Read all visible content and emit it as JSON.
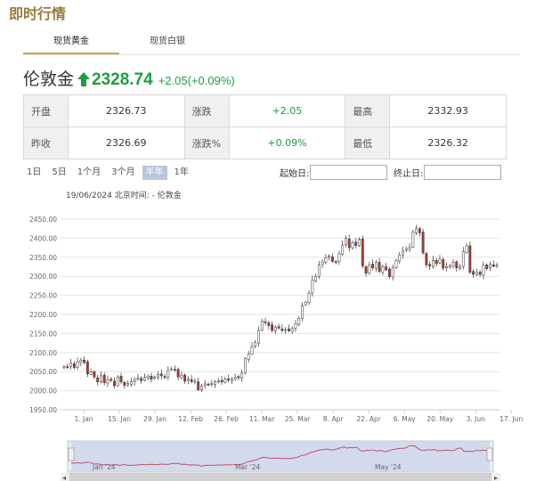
{
  "page": {
    "title": "即时行情"
  },
  "tabs": [
    {
      "label": "现货黄金",
      "active": true
    },
    {
      "label": "现货白银",
      "active": false
    }
  ],
  "quote": {
    "name": "伦敦金",
    "price": "2328.74",
    "change": "+2.05(+0.09%)",
    "direction_icon": "up-arrow-icon",
    "up_color": "#1e9e3e",
    "table": {
      "open_label": "开盘",
      "open": "2326.73",
      "change_label": "涨跌",
      "change": "+2.05",
      "high_label": "最高",
      "high": "2332.93",
      "prev_close_label": "昨收",
      "prev_close": "2326.69",
      "change_pct_label": "涨跌%",
      "change_pct": "+0.09%",
      "low_label": "最低",
      "low": "2326.32"
    }
  },
  "range_buttons": [
    {
      "label": "1日",
      "active": false
    },
    {
      "label": "5日",
      "active": false
    },
    {
      "label": "1个月",
      "active": false
    },
    {
      "label": "3个月",
      "active": false
    },
    {
      "label": "半年",
      "active": true
    },
    {
      "label": "1年",
      "active": false
    }
  ],
  "date_range": {
    "start_label": "起始日:",
    "start_value": "",
    "end_label": "终止日:",
    "end_value": ""
  },
  "chart": {
    "caption": "19/06/2024 北京时间: - 伦敦金",
    "y_ticks": [
      "2450.00",
      "2400.00",
      "2350.00",
      "2300.00",
      "2250.00",
      "2200.00",
      "2150.00",
      "2100.00",
      "2050.00",
      "2000.00",
      "1950.00"
    ],
    "x_ticks": [
      "1. Jan",
      "15. Jan",
      "29. Jan",
      "12. Feb",
      "26. Feb",
      "11. Mar",
      "25. Mar",
      "8. Apr",
      "22. Apr",
      "6. May",
      "20. May",
      "3. Jun",
      "17. Jun"
    ],
    "navigator_labels": [
      "Jan '24",
      "Mar '24",
      "May '24"
    ],
    "up_color": "#ffffff",
    "down_color": "#b03a2e",
    "wick_color": "#333333",
    "navigator_line_color": "#c0506a"
  },
  "chart_data": {
    "type": "candlestick",
    "title": "",
    "ylim": [
      1950,
      2450
    ],
    "x_first": "2024-01-01",
    "closes": [
      2063,
      2062,
      2072,
      2060,
      2076,
      2080,
      2074,
      2044,
      2049,
      2036,
      2023,
      2039,
      2021,
      2029,
      2027,
      2013,
      2036,
      2023,
      2014,
      2019,
      2023,
      2029,
      2033,
      2026,
      2035,
      2038,
      2030,
      2036,
      2043,
      2039,
      2035,
      2053,
      2057,
      2055,
      2036,
      2041,
      2025,
      2030,
      2024,
      2025,
      2002,
      2012,
      2018,
      2016,
      2019,
      2024,
      2025,
      2023,
      2030,
      2028,
      2030,
      2035,
      2034,
      2046,
      2084,
      2096,
      2115,
      2126,
      2158,
      2183,
      2178,
      2171,
      2158,
      2167,
      2164,
      2158,
      2160,
      2157,
      2163,
      2176,
      2190,
      2223,
      2232,
      2255,
      2290,
      2300,
      2329,
      2338,
      2349,
      2353,
      2339,
      2337,
      2359,
      2382,
      2400,
      2375,
      2388,
      2381,
      2397,
      2327,
      2308,
      2330,
      2322,
      2336,
      2313,
      2325,
      2317,
      2299,
      2322,
      2342,
      2356,
      2366,
      2372,
      2376,
      2416,
      2425,
      2414,
      2361,
      2330,
      2327,
      2342,
      2333,
      2345,
      2321,
      2326,
      2328,
      2336,
      2322,
      2325,
      2365,
      2380,
      2311,
      2305,
      2310,
      2305,
      2330,
      2320,
      2331,
      2326,
      2329
    ]
  }
}
